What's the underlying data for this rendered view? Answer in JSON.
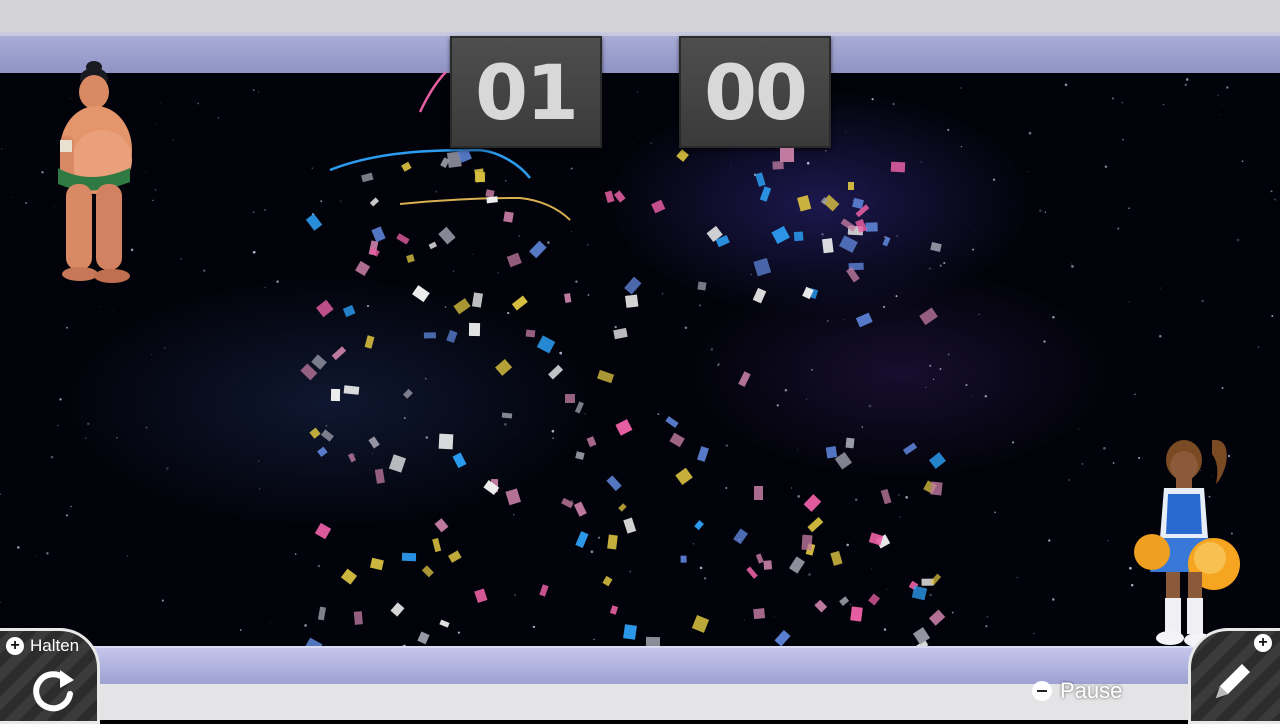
{
  "scoreboard": {
    "left_score": "01",
    "right_score": "00"
  },
  "controls": {
    "hold_label": "Halten",
    "pause_label": "Pause"
  },
  "players": {
    "left_character": "sumo-wrestler",
    "right_character": "cheerleader"
  },
  "icons": {
    "retry": "circular-arrow-icon",
    "edit": "pencil-icon",
    "plus": "plus-icon",
    "minus": "minus-icon"
  },
  "colors": {
    "wall": "#d4d4d8",
    "rail": "#9a9dd0",
    "panel": "#444444",
    "score_digits": "#d8d8d8",
    "confetti": [
      "#e85fa4",
      "#2c9cf0",
      "#d8c040",
      "#f0f0f0",
      "#9a9aa8",
      "#c07aa0",
      "#5a7fd0"
    ]
  }
}
